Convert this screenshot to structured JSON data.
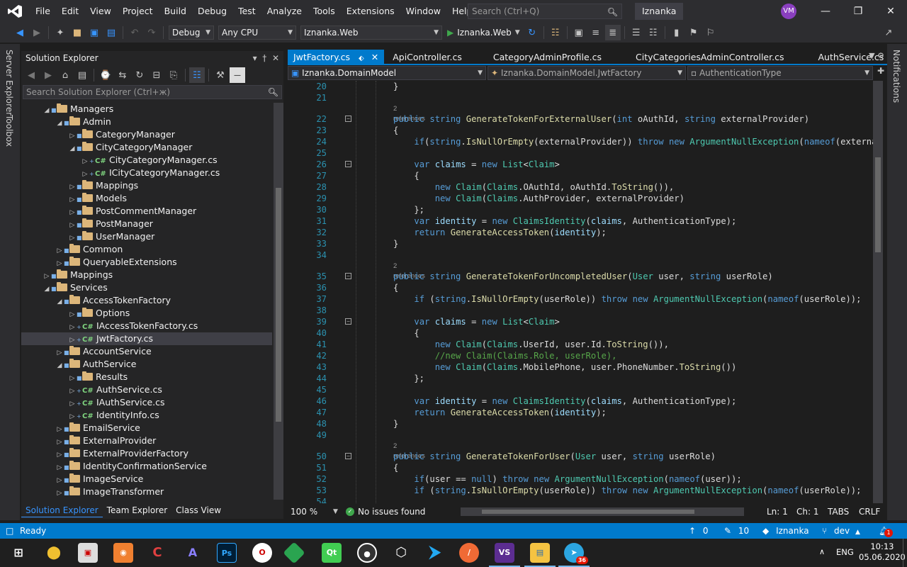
{
  "menu": [
    "File",
    "Edit",
    "View",
    "Project",
    "Build",
    "Debug",
    "Test",
    "Analyze",
    "Tools",
    "Extensions",
    "Window",
    "Help"
  ],
  "search": {
    "placeholder": "Search (Ctrl+Q)"
  },
  "solution_name": "Iznanka",
  "user_initials": "VM",
  "toolbar": {
    "config": "Debug",
    "platform": "Any CPU",
    "startup_project": "Iznanka.Web",
    "run_label": "Iznanka.Web"
  },
  "left_vtabs": [
    "Server Explorer",
    "Toolbox"
  ],
  "right_vtab": "Notifications",
  "solution_explorer": {
    "title": "Solution Explorer",
    "search_placeholder": "Search Solution Explorer (Ctrl+ж)",
    "tree": [
      {
        "label": "Managers",
        "level": 2,
        "type": "folder",
        "expanded": true
      },
      {
        "label": "Admin",
        "level": 3,
        "type": "folder",
        "expanded": true
      },
      {
        "label": "CategoryManager",
        "level": 4,
        "type": "folder",
        "expanded": false
      },
      {
        "label": "CityCategoryManager",
        "level": 4,
        "type": "folder",
        "expanded": true
      },
      {
        "label": "CityCategoryManager.cs",
        "level": 5,
        "type": "cs",
        "expanded": false
      },
      {
        "label": "ICityCategoryManager.cs",
        "level": 5,
        "type": "cs",
        "expanded": false
      },
      {
        "label": "Mappings",
        "level": 4,
        "type": "folder",
        "expanded": false
      },
      {
        "label": "Models",
        "level": 4,
        "type": "folder",
        "expanded": false
      },
      {
        "label": "PostCommentManager",
        "level": 4,
        "type": "folder",
        "expanded": false
      },
      {
        "label": "PostManager",
        "level": 4,
        "type": "folder",
        "expanded": false
      },
      {
        "label": "UserManager",
        "level": 4,
        "type": "folder",
        "expanded": false
      },
      {
        "label": "Common",
        "level": 3,
        "type": "folder",
        "expanded": false
      },
      {
        "label": "QueryableExtensions",
        "level": 3,
        "type": "folder",
        "expanded": false
      },
      {
        "label": "Mappings",
        "level": 2,
        "type": "folder",
        "expanded": false
      },
      {
        "label": "Services",
        "level": 2,
        "type": "folder",
        "expanded": true
      },
      {
        "label": "AccessTokenFactory",
        "level": 3,
        "type": "folder",
        "expanded": true
      },
      {
        "label": "Options",
        "level": 4,
        "type": "folder",
        "expanded": false
      },
      {
        "label": "IAccessTokenFactory.cs",
        "level": 4,
        "type": "cs",
        "expanded": false
      },
      {
        "label": "JwtFactory.cs",
        "level": 4,
        "type": "cs",
        "expanded": false,
        "selected": true
      },
      {
        "label": "AccountService",
        "level": 3,
        "type": "folder",
        "expanded": false
      },
      {
        "label": "AuthService",
        "level": 3,
        "type": "folder",
        "expanded": true
      },
      {
        "label": "Results",
        "level": 4,
        "type": "folder",
        "expanded": false
      },
      {
        "label": "AuthService.cs",
        "level": 4,
        "type": "cs",
        "expanded": false
      },
      {
        "label": "IAuthService.cs",
        "level": 4,
        "type": "cs",
        "expanded": false
      },
      {
        "label": "IdentityInfo.cs",
        "level": 4,
        "type": "cs",
        "expanded": false
      },
      {
        "label": "EmailService",
        "level": 3,
        "type": "folder",
        "expanded": false
      },
      {
        "label": "ExternalProvider",
        "level": 3,
        "type": "folder",
        "expanded": false
      },
      {
        "label": "ExternalProviderFactory",
        "level": 3,
        "type": "folder",
        "expanded": false
      },
      {
        "label": "IdentityConfirmationService",
        "level": 3,
        "type": "folder",
        "expanded": false
      },
      {
        "label": "ImageService",
        "level": 3,
        "type": "folder",
        "expanded": false
      },
      {
        "label": "ImageTransformer",
        "level": 3,
        "type": "folder",
        "expanded": false
      }
    ],
    "bottom_tabs": [
      "Solution Explorer",
      "Team Explorer",
      "Class View"
    ]
  },
  "editor": {
    "tabs": [
      "JwtFactory.cs",
      "ApiController.cs",
      "CategoryAdminProfile.cs",
      "CityCategoriesAdminController.cs",
      "AuthService.cs"
    ],
    "nav": [
      "Iznanka.DomainModel",
      "Iznanka.DomainModel.JwtFactory",
      "AuthenticationType"
    ],
    "lines": [
      {
        "n": "20",
        "fold": false,
        "html": "        }"
      },
      {
        "n": "21",
        "fold": false,
        "html": ""
      },
      {
        "ref": "2 references"
      },
      {
        "n": "22",
        "fold": true,
        "html": "        <span class=\"kw\">public</span> <span class=\"kw\">string</span> <span class=\"mt\">GenerateTokenForExternalUser</span>(<span class=\"kw\">int</span> oAuthId, <span class=\"kw\">string</span> externalProvider)"
      },
      {
        "n": "23",
        "fold": false,
        "html": "        {"
      },
      {
        "n": "24",
        "fold": false,
        "html": "            <span class=\"kw\">if</span>(<span class=\"kw\">string</span>.<span class=\"mt\">IsNullOrEmpty</span>(externalProvider)) <span class=\"kw\">throw</span> <span class=\"kw\">new</span> <span class=\"ty\">ArgumentNullException</span>(<span class=\"kw\">nameof</span>(externalProv"
      },
      {
        "n": "25",
        "fold": false,
        "html": ""
      },
      {
        "n": "26",
        "fold": true,
        "html": "            <span class=\"kw\">var</span> <span class=\"id\">claims</span> = <span class=\"kw\">new</span> <span class=\"ty\">List</span>&lt;<span class=\"ty\">Claim</span>&gt;"
      },
      {
        "n": "27",
        "fold": false,
        "html": "            {"
      },
      {
        "n": "28",
        "fold": false,
        "html": "                <span class=\"kw\">new</span> <span class=\"ty\">Claim</span>(<span class=\"ty\">Claims</span>.OAuthId, oAuthId.<span class=\"mt\">ToString</span>()),"
      },
      {
        "n": "29",
        "fold": false,
        "html": "                <span class=\"kw\">new</span> <span class=\"ty\">Claim</span>(<span class=\"ty\">Claims</span>.AuthProvider, externalProvider)"
      },
      {
        "n": "30",
        "fold": false,
        "html": "            };"
      },
      {
        "n": "31",
        "fold": false,
        "html": "            <span class=\"kw\">var</span> <span class=\"id\">identity</span> = <span class=\"kw\">new</span> <span class=\"ty\">ClaimsIdentity</span>(<span class=\"id\">claims</span>, AuthenticationType);"
      },
      {
        "n": "32",
        "fold": false,
        "html": "            <span class=\"kw\">return</span> <span class=\"mt\">GenerateAccessToken</span>(<span class=\"id\">identity</span>);"
      },
      {
        "n": "33",
        "fold": false,
        "html": "        }"
      },
      {
        "n": "34",
        "fold": false,
        "html": ""
      },
      {
        "ref": "2 references"
      },
      {
        "n": "35",
        "fold": true,
        "html": "        <span class=\"kw\">public</span> <span class=\"kw\">string</span> <span class=\"mt\">GenerateTokenForUncompletedUser</span>(<span class=\"ty\">User</span> user, <span class=\"kw\">string</span> userRole)"
      },
      {
        "n": "36",
        "fold": false,
        "html": "        {"
      },
      {
        "n": "37",
        "fold": false,
        "html": "            <span class=\"kw\">if</span> (<span class=\"kw\">string</span>.<span class=\"mt\">IsNullOrEmpty</span>(userRole)) <span class=\"kw\">throw</span> <span class=\"kw\">new</span> <span class=\"ty\">ArgumentNullException</span>(<span class=\"kw\">nameof</span>(userRole));"
      },
      {
        "n": "38",
        "fold": false,
        "html": ""
      },
      {
        "n": "39",
        "fold": true,
        "html": "            <span class=\"kw\">var</span> <span class=\"id\">claims</span> = <span class=\"kw\">new</span> <span class=\"ty\">List</span>&lt;<span class=\"ty\">Claim</span>&gt;"
      },
      {
        "n": "40",
        "fold": false,
        "html": "            {"
      },
      {
        "n": "41",
        "fold": false,
        "html": "                <span class=\"kw\">new</span> <span class=\"ty\">Claim</span>(<span class=\"ty\">Claims</span>.UserId, user.Id.<span class=\"mt\">ToString</span>()),"
      },
      {
        "n": "42",
        "fold": false,
        "html": "                <span class=\"cm\">//new Claim(Claims.Role, userRole),</span>"
      },
      {
        "n": "43",
        "fold": false,
        "html": "                <span class=\"kw\">new</span> <span class=\"ty\">Claim</span>(<span class=\"ty\">Claims</span>.MobilePhone, user.PhoneNumber.<span class=\"mt\">ToString</span>())"
      },
      {
        "n": "44",
        "fold": false,
        "html": "            };"
      },
      {
        "n": "45",
        "fold": false,
        "html": ""
      },
      {
        "n": "46",
        "fold": false,
        "html": "            <span class=\"kw\">var</span> <span class=\"id\">identity</span> = <span class=\"kw\">new</span> <span class=\"ty\">ClaimsIdentity</span>(<span class=\"id\">claims</span>, AuthenticationType);"
      },
      {
        "n": "47",
        "fold": false,
        "html": "            <span class=\"kw\">return</span> <span class=\"mt\">GenerateAccessToken</span>(<span class=\"id\">identity</span>);"
      },
      {
        "n": "48",
        "fold": false,
        "html": "        }"
      },
      {
        "n": "49",
        "fold": false,
        "html": ""
      },
      {
        "ref": "2 references"
      },
      {
        "n": "50",
        "fold": true,
        "html": "        <span class=\"kw\">public</span> <span class=\"kw\">string</span> <span class=\"mt\">GenerateTokenForUser</span>(<span class=\"ty\">User</span> user, <span class=\"kw\">string</span> userRole)"
      },
      {
        "n": "51",
        "fold": false,
        "html": "        {"
      },
      {
        "n": "52",
        "fold": false,
        "html": "            <span class=\"kw\">if</span>(user == <span class=\"kw\">null</span>) <span class=\"kw\">throw</span> <span class=\"kw\">new</span> <span class=\"ty\">ArgumentNullException</span>(<span class=\"kw\">nameof</span>(user));"
      },
      {
        "n": "53",
        "fold": false,
        "html": "            <span class=\"kw\">if</span> (<span class=\"kw\">string</span>.<span class=\"mt\">IsNullOrEmpty</span>(userRole)) <span class=\"kw\">throw</span> <span class=\"kw\">new</span> <span class=\"ty\">ArgumentNullException</span>(<span class=\"kw\">nameof</span>(userRole));"
      },
      {
        "n": "54",
        "fold": false,
        "html": ""
      }
    ],
    "status": {
      "zoom": "100 %",
      "issues": "No issues found",
      "line": "Ln: 1",
      "col": "Ch: 1",
      "tabs": "TABS",
      "eol": "CRLF"
    }
  },
  "statusbar": {
    "ready": "Ready",
    "up_count": "0",
    "edit_count": "10",
    "repo": "Iznanka",
    "branch": "dev",
    "notif_count": "1"
  },
  "taskbar": {
    "lang": "ENG",
    "time": "10:13",
    "date": "05.06.2020",
    "telegram_badge": "36"
  },
  "colors": {
    "accent": "#007acc",
    "background": "#1e1e1e",
    "panel": "#252526",
    "chrome": "#2d2d30"
  }
}
